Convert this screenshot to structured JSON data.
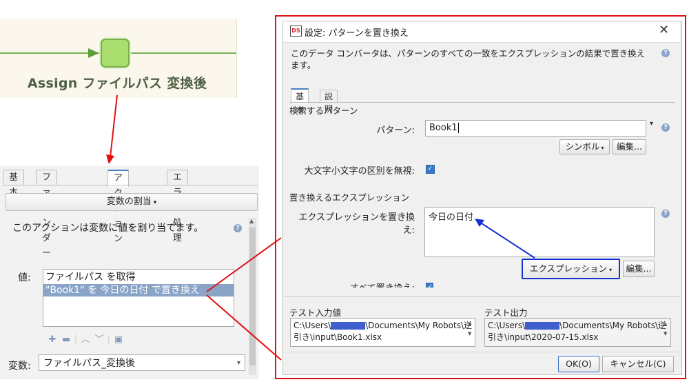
{
  "workflow": {
    "step_label": "Assign ファイルパス 変換後"
  },
  "action_panel": {
    "tabs": [
      "基本",
      "ファインダー",
      "アクション",
      "エラー処理"
    ],
    "active_tab": "アクション",
    "assign_button": "変数の割当",
    "description": "このアクションは変数に値を割り当てます。",
    "value_label": "値:",
    "value_items": [
      "ファイルパス を取得",
      "\"Book1\" を 今日の日付 で置き換え"
    ],
    "variable_label": "変数:",
    "variable_value": "ファイルパス_変換後"
  },
  "dialog": {
    "logo": "DS",
    "title": "設定: パターンを置き換え",
    "description": "このデータ コンバータは、パターンのすべての一致をエクスプレッションの結果で置き換えます。",
    "tabs": [
      "基本",
      "説明"
    ],
    "active_tab": "基本",
    "search_section": "検索するパターン",
    "pattern_label": "パターン:",
    "pattern_value": "Book1",
    "symbol_button": "シンボル",
    "edit_button": "編集...",
    "ignore_case_label": "大文字小文字の区別を無視:",
    "ignore_case_checked": true,
    "replace_section": "置き換えるエクスプレッション",
    "replace_label": "エクスプレッションを置き換え:",
    "replace_value": "今日の日付",
    "expression_button": "エクスプレッション",
    "edit_button_2": "編集...",
    "replace_all_label": "すべて置き換え:",
    "test_input_label": "テスト入力値",
    "test_input_line1_prefix": "C:\\Users\\",
    "test_input_line1_suffix": "\\Documents\\My Robots\\逆",
    "test_input_line2": "引き\\input\\Book1.xlsx",
    "test_output_label": "テスト出力",
    "test_output_line1_prefix": "C:\\Users\\",
    "test_output_line1_suffix": "\\Documents\\My Robots\\逆",
    "test_output_line2": "引き\\input\\2020-07-15.xlsx",
    "ok_button": "OK(O)",
    "cancel_button": "キャンセル(C)"
  },
  "colors": {
    "annotation_red": "#e01010",
    "annotation_blue": "#1530d0",
    "selection": "#8aa4c8",
    "node_green": "#a9dd6d"
  }
}
